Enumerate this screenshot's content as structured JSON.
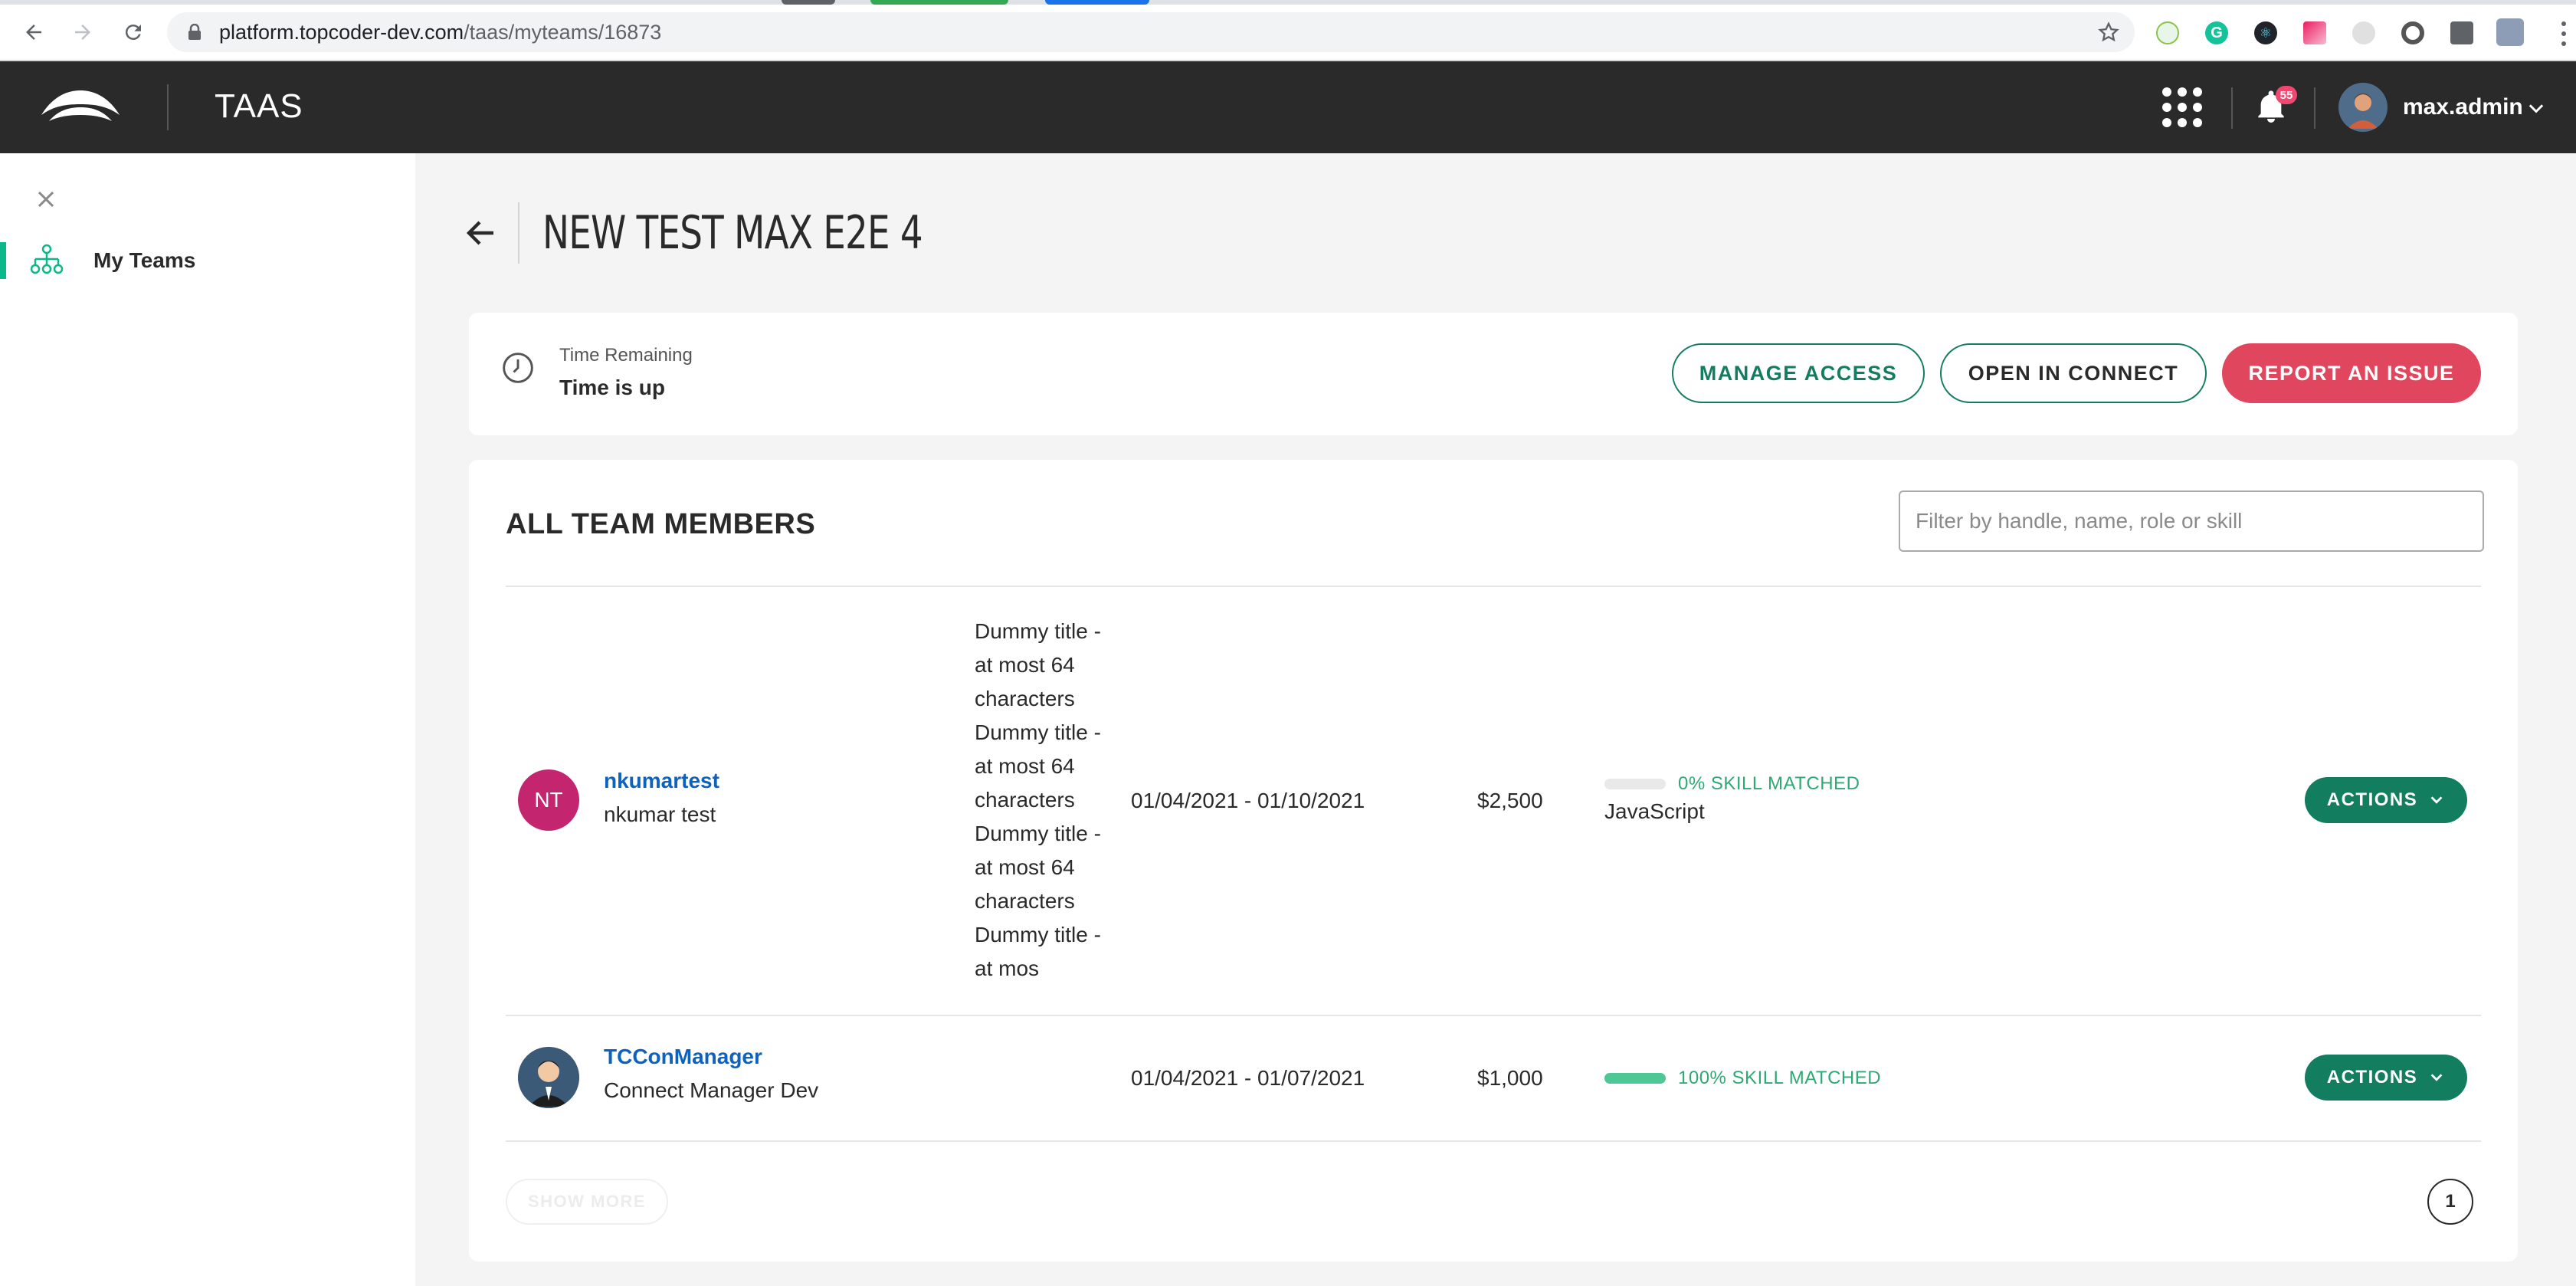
{
  "browser": {
    "url_host": "platform.topcoder-dev.com",
    "url_path": "/taas/myteams/16873"
  },
  "header": {
    "app_title": "TAAS",
    "notification_count": "55",
    "username": "max.admin"
  },
  "sidebar": {
    "items": [
      {
        "label": "My Teams"
      }
    ]
  },
  "page": {
    "title": "NEW TEST MAX E2E 4"
  },
  "summary": {
    "time_remaining_label": "Time Remaining",
    "time_remaining_value": "Time is up",
    "buttons": {
      "manage_access": "MANAGE ACCESS",
      "open_in_connect": "OPEN IN CONNECT",
      "report_issue": "REPORT AN ISSUE"
    }
  },
  "members": {
    "section_title": "ALL TEAM MEMBERS",
    "filter_placeholder": "Filter by handle, name, role or skill",
    "rows": [
      {
        "initials": "NT",
        "handle": "nkumartest",
        "name": "nkumar test",
        "job_title_lines": [
          "Dummy title -",
          "at most 64",
          "characters",
          "Dummy title -",
          "at most 64",
          "characters",
          "Dummy title -",
          "at most 64",
          "characters",
          "Dummy title -",
          "at mos"
        ],
        "dates": "01/04/2021 - 01/10/2021",
        "rate": "$2,500",
        "skill_match_percent": 0,
        "skill_match_text": "0% SKILL MATCHED",
        "skills": "JavaScript",
        "actions_label": "ACTIONS"
      },
      {
        "handle": "TCConManager",
        "name": "Connect Manager Dev",
        "dates": "01/04/2021 - 01/07/2021",
        "rate": "$1,000",
        "skill_match_percent": 100,
        "skill_match_text": "100% SKILL MATCHED",
        "actions_label": "ACTIONS"
      }
    ],
    "show_more_label": "SHOW MORE",
    "current_page": "1"
  },
  "colors": {
    "accent_green": "#137d60",
    "report_red": "#e0475e",
    "skill_green": "#4dc794",
    "handle_blue": "#0d61bf",
    "header_bg": "#2a2a2a"
  }
}
